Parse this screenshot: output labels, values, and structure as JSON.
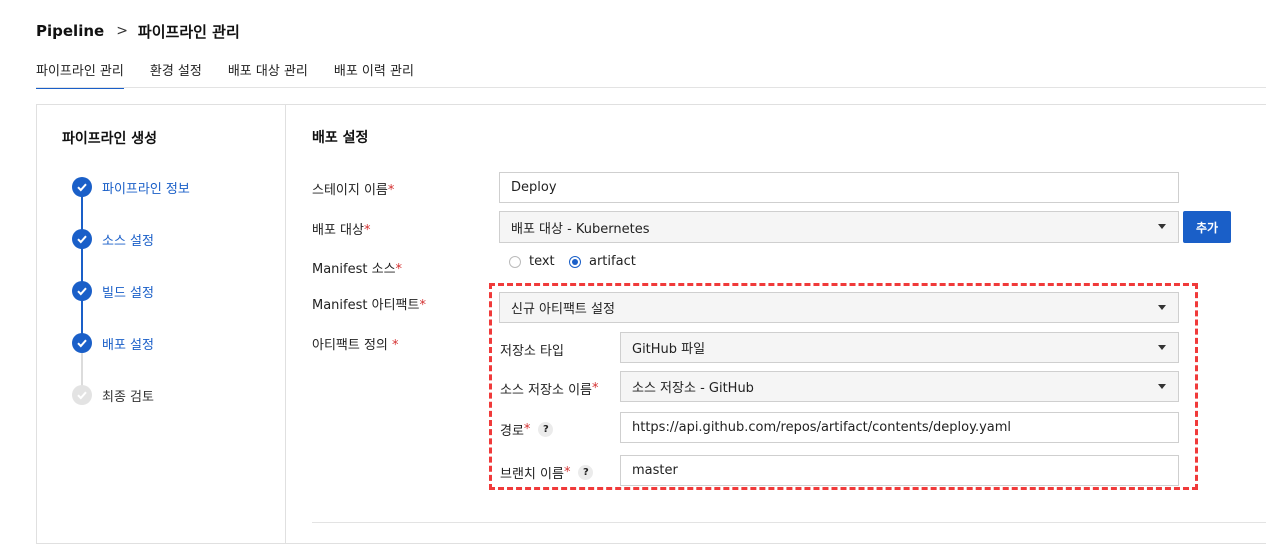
{
  "breadcrumb": {
    "root": "Pipeline",
    "separator": ">",
    "current": "파이프라인 관리"
  },
  "tabs": [
    {
      "label": "파이프라인 관리",
      "active": true
    },
    {
      "label": "환경 설정",
      "active": false
    },
    {
      "label": "배포 대상 관리",
      "active": false
    },
    {
      "label": "배포 이력 관리",
      "active": false
    }
  ],
  "sidebar": {
    "title": "파이프라인 생성",
    "steps": [
      {
        "label": "파이프라인 정보",
        "done": true
      },
      {
        "label": "소스 설정",
        "done": true
      },
      {
        "label": "빌드 설정",
        "done": true
      },
      {
        "label": "배포 설정",
        "done": true
      },
      {
        "label": "최종 검토",
        "done": false
      }
    ]
  },
  "form": {
    "section_title": "배포 설정",
    "required_mark": "*",
    "stage_name": {
      "label": "스테이지 이름",
      "value": "Deploy"
    },
    "deploy_target": {
      "label": "배포 대상",
      "value": "배포 대상 - Kubernetes",
      "add_button": "추가"
    },
    "manifest_source": {
      "label": "Manifest 소스",
      "options": [
        {
          "label": "text",
          "selected": false
        },
        {
          "label": "artifact",
          "selected": true
        }
      ]
    },
    "manifest_artifact": {
      "label": "Manifest 아티팩트",
      "value": "신규 아티팩트 설정"
    },
    "artifact_definition": {
      "label": "아티팩트 정의 ",
      "repo_type": {
        "label": "저장소 타입",
        "value": "GitHub 파일"
      },
      "source_repo_name": {
        "label": "소스 저장소 이름",
        "value": "소스 저장소 - GitHub"
      },
      "path": {
        "label": "경로 ",
        "value": "https://api.github.com/repos/artifact/contents/deploy.yaml",
        "help": "?"
      },
      "branch_name": {
        "label": "브랜치 이름 ",
        "value": "master",
        "help": "?"
      }
    }
  },
  "colors": {
    "accent": "#1a5fc8",
    "required": "#d32f2f",
    "highlight_border": "#f03a3a"
  },
  "icons": {
    "step_done": "check-icon",
    "dropdown": "caret-down-icon",
    "help": "question-icon",
    "breadcrumb_sep": "chevron-right-icon"
  }
}
